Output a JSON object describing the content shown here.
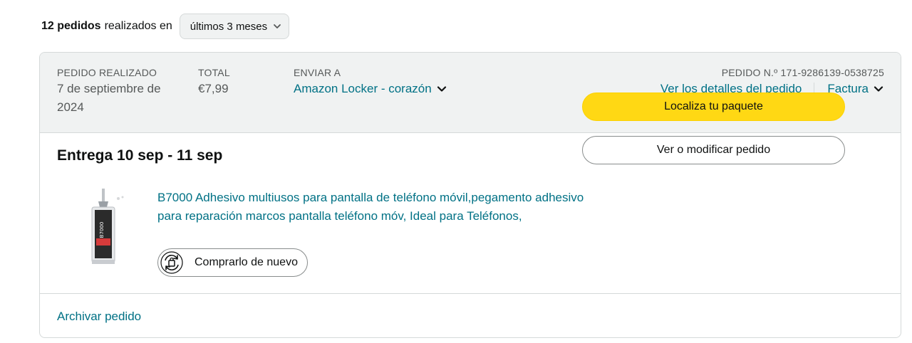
{
  "summary": {
    "count": "12 pedidos",
    "text": "realizados en",
    "range_selected": "últimos 3 meses",
    "range_icon": "chevron-down-icon"
  },
  "order": {
    "placed_label": "PEDIDO REALIZADO",
    "placed_value": "7 de septiembre de 2024",
    "total_label": "TOTAL",
    "total_value": "€7,99",
    "ship_label": "ENVIAR A",
    "ship_value": "Amazon Locker - corazón",
    "order_number": "PEDIDO N.º 171-9286139-0538725",
    "details_link": "Ver los detalles del pedido",
    "invoice_link": "Factura",
    "delivery": "Entrega 10 sep - 11 sep",
    "product": {
      "title": "B7000 Adhesivo multiusos para pantalla de teléfono móvil,pegamento adhesivo para reparación marcos pantalla teléfono móv, Ideal para Teléfonos,",
      "image": "glue-tube-image",
      "image_text": "B7000"
    },
    "buy_again": "Comprarlo de nuevo",
    "track_button": "Localiza tu paquete",
    "view_button": "Ver o modificar pedido",
    "archive_link": "Archivar pedido"
  },
  "colors": {
    "link": "#007185",
    "primary_button": "#ffd814",
    "header_bg": "#f0f2f2",
    "border": "#d5d9d9",
    "muted_text": "#565959"
  }
}
